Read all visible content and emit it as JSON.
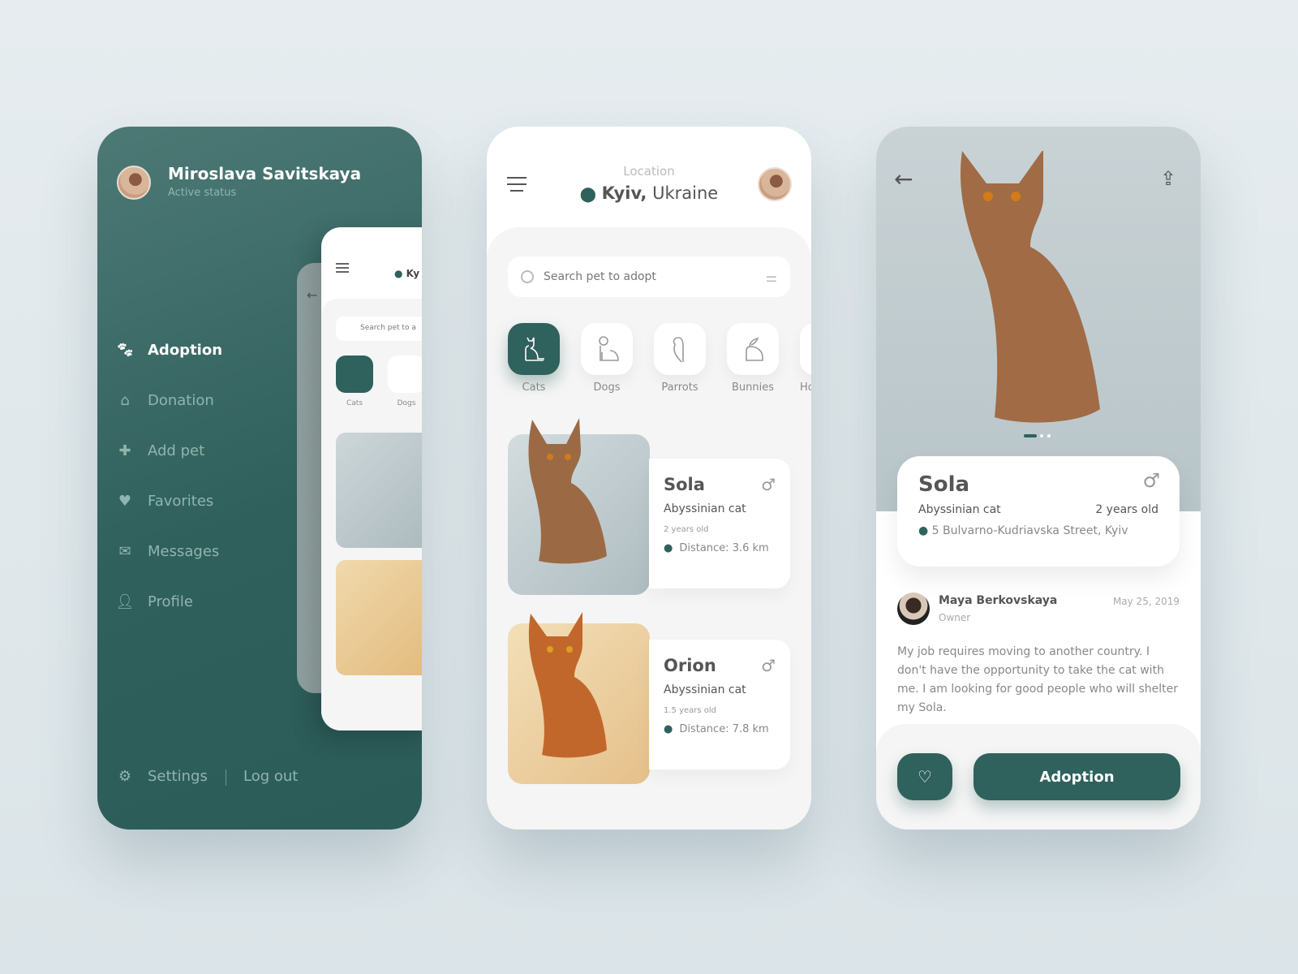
{
  "colors": {
    "brand": "#2f615d",
    "background": "#e2e9ec"
  },
  "drawer": {
    "user_name": "Miroslava Savitskaya",
    "user_status": "Active status",
    "items": [
      {
        "label": "Adoption",
        "icon": "paw-icon",
        "active": true
      },
      {
        "label": "Donation",
        "icon": "donation-house-icon",
        "active": false
      },
      {
        "label": "Add pet",
        "icon": "plus-icon",
        "active": false
      },
      {
        "label": "Favorites",
        "icon": "heart-icon",
        "active": false
      },
      {
        "label": "Messages",
        "icon": "envelope-icon",
        "active": false
      },
      {
        "label": "Profile",
        "icon": "person-icon",
        "active": false
      }
    ],
    "settings_label": "Settings",
    "logout_label": "Log out",
    "preview": {
      "location_short": "Ky",
      "search_short": "Search pet to a",
      "cats": "Cats",
      "dogs": "Dogs"
    }
  },
  "home": {
    "location_label": "Location",
    "city": "Kyiv,",
    "country": "Ukraine",
    "search_placeholder": "Search pet to adopt",
    "categories": [
      {
        "label": "Cats",
        "selected": true
      },
      {
        "label": "Dogs",
        "selected": false
      },
      {
        "label": "Parrots",
        "selected": false
      },
      {
        "label": "Bunnies",
        "selected": false
      },
      {
        "label": "Ho",
        "selected": false
      }
    ],
    "pets": [
      {
        "name": "Sola",
        "breed": "Abyssinian cat",
        "age": "2 years old",
        "distance": "Distance: 3.6 km",
        "gender": "male"
      },
      {
        "name": "Orion",
        "breed": "Abyssinian cat",
        "age": "1.5 years old",
        "distance": "Distance: 7.8 km",
        "gender": "male"
      }
    ]
  },
  "detail": {
    "name": "Sola",
    "breed": "Abyssinian cat",
    "age": "2 years old",
    "address": "5 Bulvarno-Kudriavska Street, Kyiv",
    "gender": "male",
    "image_count": 3,
    "current_image": 1,
    "owner_name": "Maya Berkovskaya",
    "owner_role": "Owner",
    "date": "May 25, 2019",
    "description": "My job requires moving to another country. I don't have the opportunity to take the cat with me. I am looking for good people who will shelter my Sola.",
    "adopt_label": "Adoption"
  }
}
